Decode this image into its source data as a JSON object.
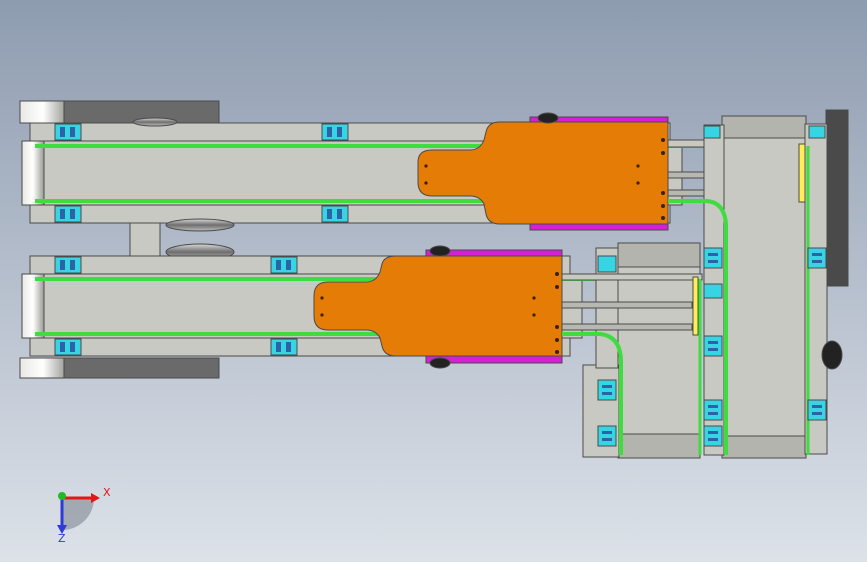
{
  "colors": {
    "background_top": "#8e9cb0",
    "background_bottom": "#dde2e9",
    "frame": "#c9c9c3",
    "frame_edge": "#4a4a4a",
    "belt_green": "#3fdc3f",
    "tray_orange": "#e57c06",
    "magenta": "#d61fd6",
    "clip_cyan": "#37d5e4",
    "clip_blue": "#2b63a6",
    "yellow": "#ffee55",
    "roller_dark": "#5a5a5a",
    "axis_x": "#e01818",
    "axis_y": "#22b922",
    "axis_z": "#2e3bd6"
  },
  "axes": {
    "x_label": "X",
    "z_label": "Z"
  }
}
